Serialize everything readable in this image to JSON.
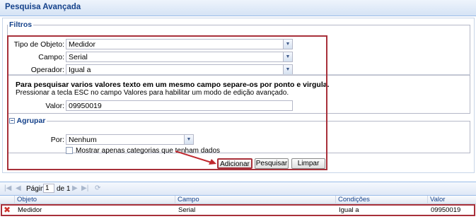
{
  "window": {
    "title": "Pesquisa Avançada"
  },
  "filters": {
    "legend": "Filtros",
    "object_type": {
      "label": "Tipo de Objeto:",
      "value": "Medidor"
    },
    "field": {
      "label": "Campo:",
      "value": "Serial"
    },
    "operator": {
      "label": "Operador:",
      "value": "Igual a"
    },
    "info_bold": "Para pesquisar varios valores texto em um mesmo campo separe-os por ponto e virgula.",
    "info": "Pressionar a tecla ESC no campo Valores para habilitar um modo de edição avançado.",
    "value": {
      "label": "Valor:",
      "value": "09950019"
    }
  },
  "group": {
    "legend": "Agrupar",
    "collapse_icon": "minus",
    "by": {
      "label": "Por:",
      "value": "Nenhum"
    },
    "checkbox_label": "Mostrar apenas categorias que tenham dados"
  },
  "buttons": {
    "add": "Adicionar",
    "search": "Pesquisar",
    "clear": "Limpar"
  },
  "pager": {
    "page_label": "Página",
    "page_value": "1",
    "of_label": "de 1"
  },
  "grid": {
    "columns": [
      "Objeto",
      "Campo",
      "Condições",
      "Valor"
    ],
    "rows": [
      {
        "objeto": "Medidor",
        "campo": "Serial",
        "condicoes": "Igual a",
        "valor": "09950019"
      }
    ]
  },
  "colors": {
    "highlight": "#a8303a",
    "title": "#15428b",
    "arrow": "#c0282e"
  }
}
